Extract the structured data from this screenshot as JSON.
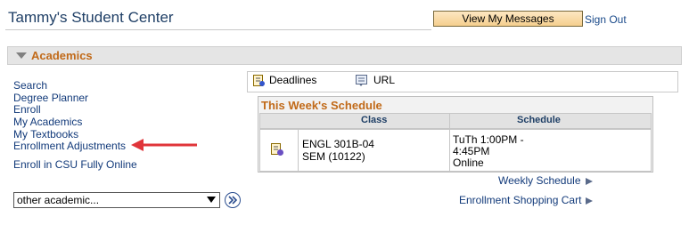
{
  "header": {
    "title": "Tammy's Student Center",
    "view_messages_label": "View My Messages",
    "sign_out_label": "Sign Out"
  },
  "academics": {
    "section_label": "Academics",
    "links": [
      "Search",
      "Degree Planner",
      "Enroll",
      "My Academics",
      "My Textbooks",
      "Enrollment Adjustments"
    ],
    "extra_link": "Enroll in CSU Fully Online",
    "select_value": "other academic..."
  },
  "toolbar": {
    "deadlines_label": "Deadlines",
    "url_label": "URL"
  },
  "schedule": {
    "title": "This Week's Schedule",
    "columns": [
      "Class",
      "Schedule"
    ],
    "row": {
      "class_line1": "ENGL 301B-04",
      "class_line2": "SEM (10122)",
      "sched_line1": "TuTh 1:00PM -",
      "sched_line2": "4:45PM",
      "sched_line3": "Online"
    },
    "weekly_link": "Weekly Schedule",
    "cart_link": "Enrollment Shopping Cart"
  },
  "colors": {
    "accent_orange": "#c16a19",
    "link_blue": "#123a7a",
    "arrow_red": "#e0353a"
  }
}
